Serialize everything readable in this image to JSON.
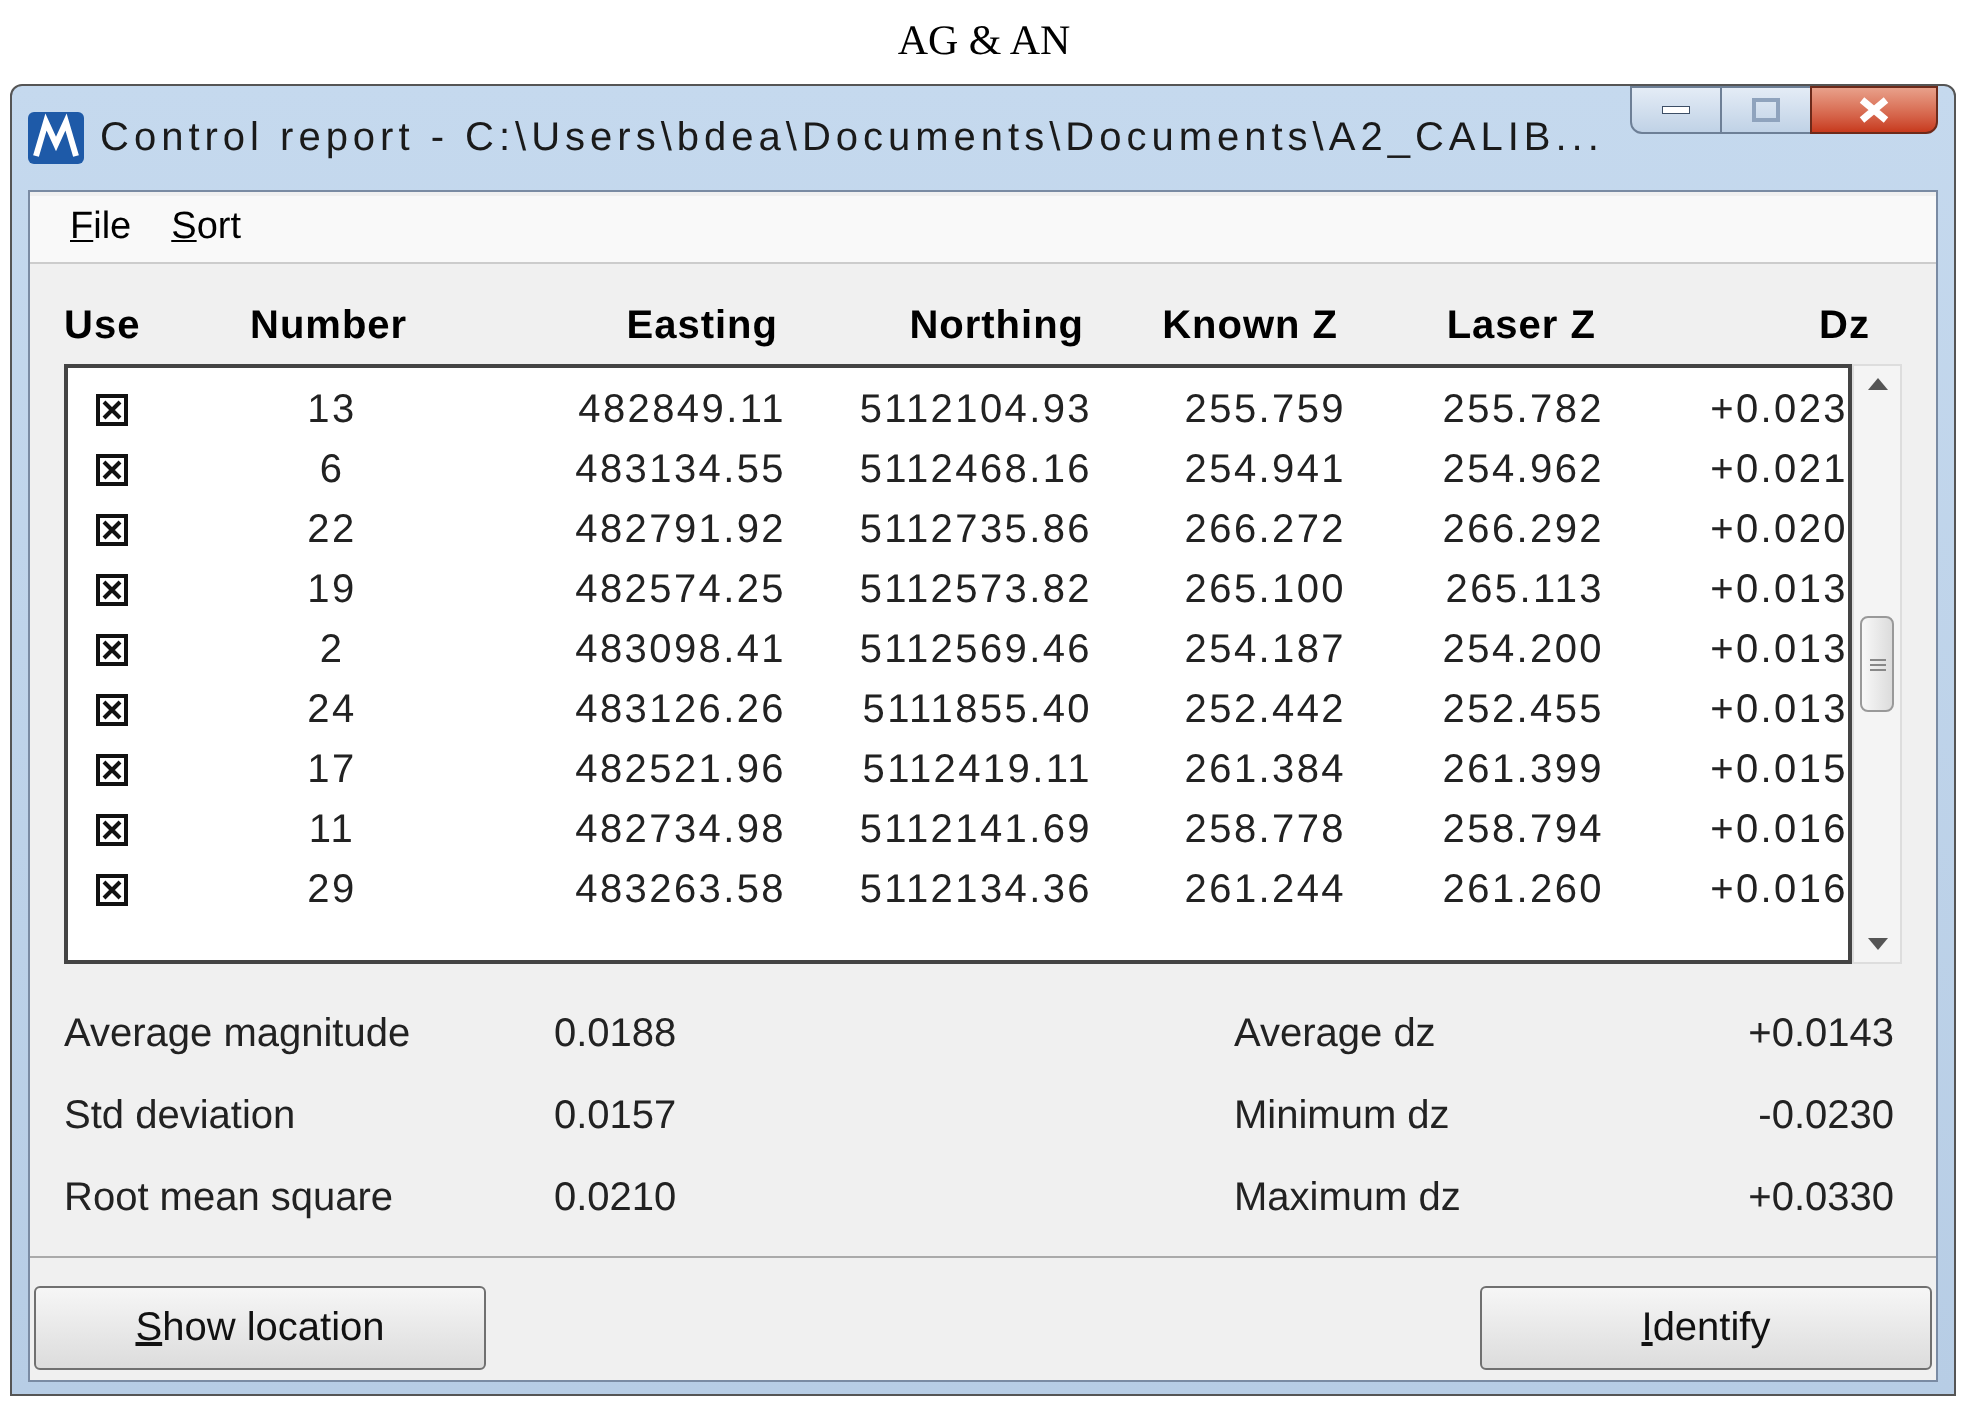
{
  "caption": "AG & AN",
  "window": {
    "title": "Control report - C:\\Users\\bdea\\Documents\\Documents\\A2_CALIB..."
  },
  "menu": [
    {
      "label": "File",
      "mnemonic": true
    },
    {
      "label": "Sort",
      "mnemonic": true
    }
  ],
  "table": {
    "columns": [
      "Use",
      "Number",
      "Easting",
      "Northing",
      "Known Z",
      "Laser Z",
      "Dz"
    ],
    "rows": [
      {
        "checked": true,
        "cells": [
          "",
          "13",
          "482849.11",
          "5112104.93",
          "255.759",
          "255.782",
          "+0.023"
        ]
      },
      {
        "checked": true,
        "cells": [
          "",
          "6",
          "483134.55",
          "5112468.16",
          "254.941",
          "254.962",
          "+0.021"
        ]
      },
      {
        "checked": true,
        "cells": [
          "",
          "22",
          "482791.92",
          "5112735.86",
          "266.272",
          "266.292",
          "+0.020"
        ]
      },
      {
        "checked": true,
        "cells": [
          "",
          "19",
          "482574.25",
          "5112573.82",
          "265.100",
          "265.113",
          "+0.013"
        ]
      },
      {
        "checked": true,
        "cells": [
          "",
          "2",
          "483098.41",
          "5112569.46",
          "254.187",
          "254.200",
          "+0.013"
        ]
      },
      {
        "checked": true,
        "cells": [
          "",
          "24",
          "483126.26",
          "5111855.40",
          "252.442",
          "252.455",
          "+0.013"
        ]
      },
      {
        "checked": true,
        "cells": [
          "",
          "17",
          "482521.96",
          "5112419.11",
          "261.384",
          "261.399",
          "+0.015"
        ]
      },
      {
        "checked": true,
        "cells": [
          "",
          "11",
          "482734.98",
          "5112141.69",
          "258.778",
          "258.794",
          "+0.016"
        ]
      },
      {
        "checked": true,
        "cells": [
          "",
          "29",
          "483263.58",
          "5112134.36",
          "261.244",
          "261.260",
          "+0.016"
        ]
      }
    ]
  },
  "stats_left": [
    {
      "label": "Average magnitude",
      "value": "0.0188"
    },
    {
      "label": "Std deviation",
      "value": "0.0157"
    },
    {
      "label": "Root mean square",
      "value": "0.0210"
    }
  ],
  "stats_right": [
    {
      "label": "Average dz",
      "value": "+0.0143"
    },
    {
      "label": "Minimum dz",
      "value": "-0.0230"
    },
    {
      "label": "Maximum dz",
      "value": "+0.0330"
    }
  ],
  "buttons": [
    {
      "label": "Show location",
      "mnemonic": true
    },
    {
      "label": "Identify",
      "mnemonic": true
    }
  ]
}
